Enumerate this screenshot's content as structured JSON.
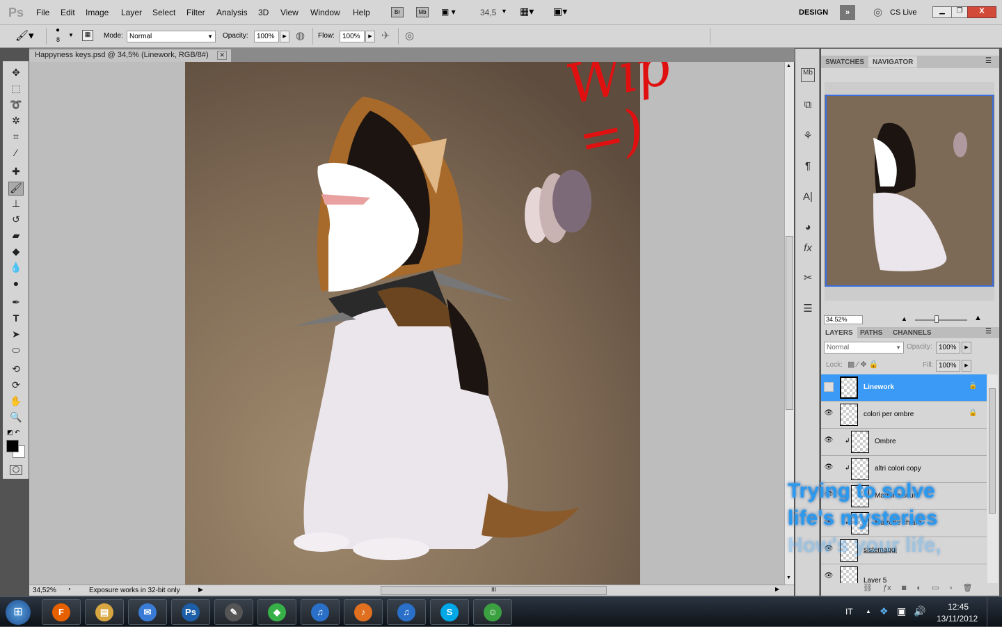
{
  "app": {
    "logo": "Ps",
    "menus": [
      "File",
      "Edit",
      "Image",
      "Layer",
      "Select",
      "Filter",
      "Analysis",
      "3D",
      "View",
      "Window",
      "Help"
    ],
    "bridge": "Br",
    "minibridge": "Mb",
    "zoom_value": "34,5",
    "workspace": "DESIGN",
    "cs_live": "CS Live"
  },
  "options": {
    "brush_size": "8",
    "mode_label": "Mode:",
    "mode_value": "Normal",
    "opacity_label": "Opacity:",
    "opacity_value": "100%",
    "flow_label": "Flow:",
    "flow_value": "100%"
  },
  "document": {
    "tab_title": "Happyness keys.psd @ 34,5% (Linework, RGB/8#)",
    "status_zoom": "34,52%",
    "status_text": "Exposure works in 32-bit only",
    "scroll_mark": "III"
  },
  "painting": {
    "scribble": "Wip =)"
  },
  "navigator": {
    "tabs": [
      "SWATCHES",
      "NAVIGATOR"
    ],
    "zoom": "34.52%"
  },
  "layers": {
    "tabs": [
      "LAYERS",
      "PATHS",
      "CHANNELS"
    ],
    "blend_mode": "Normal",
    "opacity_label": "Opacity:",
    "opacity_value": "100%",
    "lock_label": "Lock:",
    "fill_label": "Fill:",
    "fill_value": "100%",
    "items": [
      {
        "name": "Linework",
        "visible": false,
        "locked": true,
        "selected": true,
        "clipped": false
      },
      {
        "name": "colori per ombre",
        "visible": true,
        "locked": true,
        "clipped": false
      },
      {
        "name": "Ombre",
        "visible": true,
        "clipped": true
      },
      {
        "name": "altri colori copy",
        "visible": true,
        "clipped": true
      },
      {
        "name": "Marrone scuro",
        "visible": true,
        "clipped": true
      },
      {
        "name": "Marrone chiaro",
        "visible": true,
        "clipped": true
      },
      {
        "name": "sistemaggi",
        "visible": true,
        "clipped": false
      },
      {
        "name": "Layer 5",
        "visible": true,
        "clipped": false
      }
    ]
  },
  "overlay": {
    "line1": "Trying to solve",
    "line2": "life's mysteries",
    "line3": "How's your life,"
  },
  "taskbar": {
    "apps": [
      {
        "name": "firefox",
        "glyph": "F",
        "color": "#e66000"
      },
      {
        "name": "explorer",
        "glyph": "▤",
        "color": "#d8a640"
      },
      {
        "name": "thunderbird",
        "glyph": "✉",
        "color": "#3a7bd5"
      },
      {
        "name": "photoshop",
        "glyph": "Ps",
        "color": "#1c5fa8"
      },
      {
        "name": "inkscape",
        "glyph": "✎",
        "color": "#555"
      },
      {
        "name": "sims",
        "glyph": "◆",
        "color": "#38b048"
      },
      {
        "name": "itunes",
        "glyph": "♫",
        "color": "#2a70c8"
      },
      {
        "name": "music",
        "glyph": "♪",
        "color": "#e07020"
      },
      {
        "name": "itunes-2",
        "glyph": "♫",
        "color": "#2a70c8"
      },
      {
        "name": "skype",
        "glyph": "S",
        "color": "#00a8e8"
      },
      {
        "name": "messenger",
        "glyph": "☺",
        "color": "#3aa040"
      }
    ],
    "lang": "IT",
    "time": "12:45",
    "date": "13/11/2012"
  }
}
